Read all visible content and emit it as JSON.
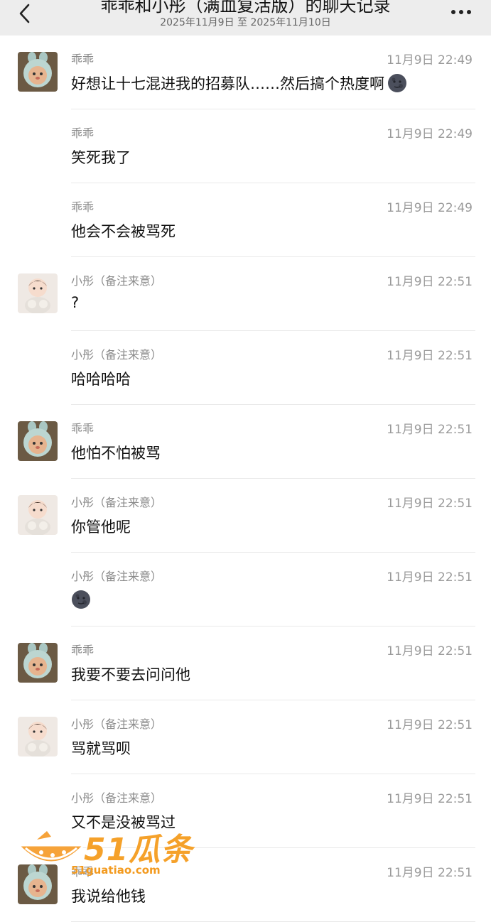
{
  "header": {
    "title": "乖乖和小彤（满血复活版）的聊天记录",
    "date_range": "2025年11月9日 至 2025年11月10日"
  },
  "colors": {
    "header_bg": "#ededed",
    "sender": "#8a8a8a",
    "time": "#9a9a9a",
    "divider": "#e9e9e9",
    "watermark": "#f39a1e"
  },
  "avatars": {
    "guaiguai": "cartoon-mushroom-avatar",
    "xiaotong": "baby-doll-avatar"
  },
  "messages": [
    {
      "sender": "乖乖",
      "time": "11月9日 22:49",
      "text": "好想让十七混进我的招募队……然后搞个热度啊",
      "avatar": "guaiguai",
      "emoji": "new-moon-face"
    },
    {
      "sender": "乖乖",
      "time": "11月9日 22:49",
      "text": "笑死我了",
      "avatar": ""
    },
    {
      "sender": "乖乖",
      "time": "11月9日 22:49",
      "text": "他会不会被骂死",
      "avatar": ""
    },
    {
      "sender": "小彤（备注来意）",
      "time": "11月9日 22:51",
      "text": "?",
      "avatar": "xiaotong"
    },
    {
      "sender": "小彤（备注来意）",
      "time": "11月9日 22:51",
      "text": "哈哈哈哈",
      "avatar": ""
    },
    {
      "sender": "乖乖",
      "time": "11月9日 22:51",
      "text": "他怕不怕被骂",
      "avatar": "guaiguai"
    },
    {
      "sender": "小彤（备注来意）",
      "time": "11月9日 22:51",
      "text": "你管他呢",
      "avatar": "xiaotong"
    },
    {
      "sender": "小彤（备注来意）",
      "time": "11月9日 22:51",
      "text": "",
      "avatar": "",
      "emoji": "new-moon-face"
    },
    {
      "sender": "乖乖",
      "time": "11月9日 22:51",
      "text": "我要不要去问问他",
      "avatar": "guaiguai"
    },
    {
      "sender": "小彤（备注来意）",
      "time": "11月9日 22:51",
      "text": "骂就骂呗",
      "avatar": "xiaotong"
    },
    {
      "sender": "小彤（备注来意）",
      "time": "11月9日 22:51",
      "text": "又不是没被骂过",
      "avatar": ""
    },
    {
      "sender": "乖乖",
      "time": "11月9日 22:51",
      "text": "我说给他钱",
      "avatar": "guaiguai"
    }
  ],
  "watermark": {
    "logo": "51瓜条",
    "url": "51guatiao.com"
  }
}
